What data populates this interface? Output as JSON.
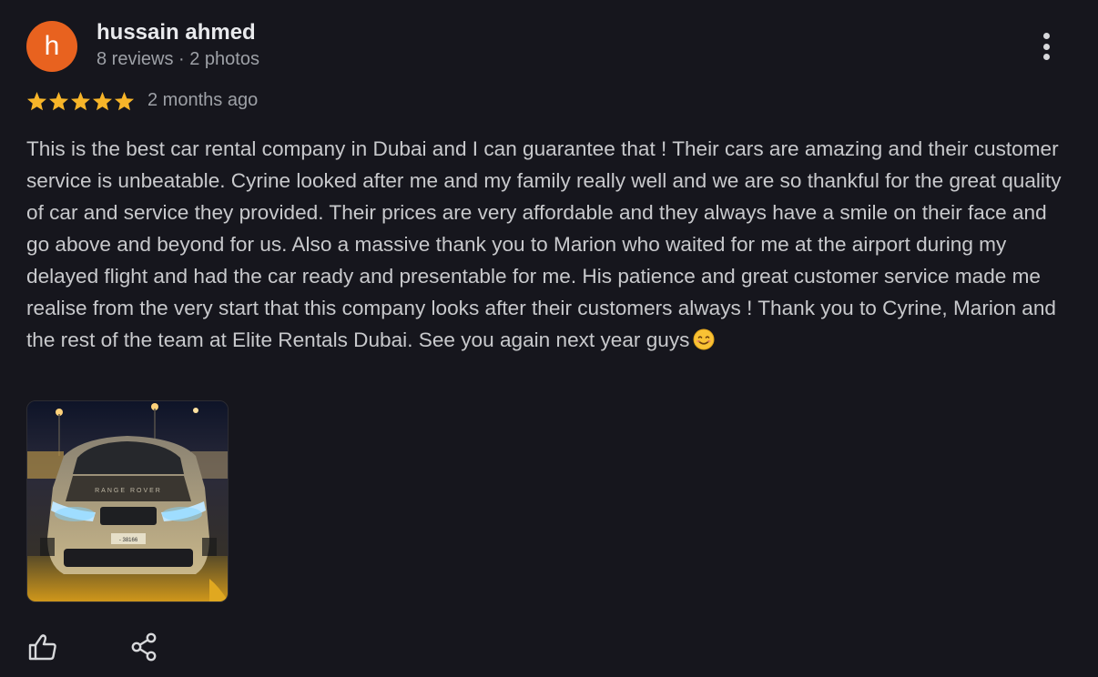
{
  "reviewer": {
    "avatar_letter": "h",
    "name": "hussain ahmed",
    "meta": "8 reviews · 2 photos"
  },
  "review": {
    "rating": 5,
    "date": "2 months ago",
    "text": "This is the best car rental company in Dubai and I can guarantee that ! Their cars are amazing and their customer service is unbeatable. Cyrine looked after me and my family really well and we are so thankful for the great quality of car and service they provided. Their prices are very affordable and they always have a smile on their face and go above and beyond for us. Also a massive thank you to Marion who waited for me at the airport during my delayed flight and had the car ready and presentable for me. His patience and great customer service made me realise from the very start that this company looks after their customers always ! Thank you to Cyrine, Marion and the rest of the team at Elite Rentals Dubai. See you again next year guys",
    "emoji": "smiling-face-emoji"
  },
  "icons": {
    "more": "more-vertical-icon",
    "like": "thumbs-up-icon",
    "share": "share-icon",
    "star": "star-icon"
  },
  "colors": {
    "background": "#16161d",
    "avatar": "#e8621f",
    "star": "#f7b529",
    "text": "#c8c9cc",
    "muted": "#9da0a6"
  }
}
